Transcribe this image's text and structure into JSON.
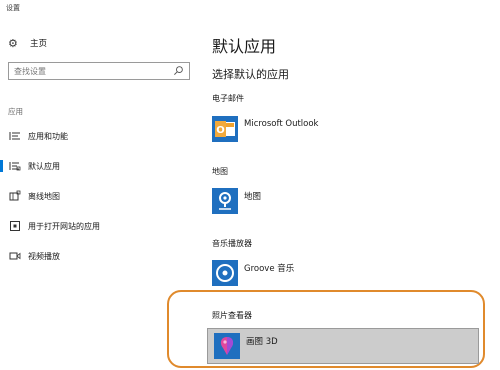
{
  "window": {
    "title": "设置"
  },
  "sidebar": {
    "home_label": "主页",
    "search_placeholder": "查找设置",
    "section_label": "应用",
    "items": [
      {
        "label": "应用和功能",
        "icon": "list-icon",
        "active": false
      },
      {
        "label": "默认应用",
        "icon": "default-apps-icon",
        "active": true
      },
      {
        "label": "离线地图",
        "icon": "map-icon",
        "active": false
      },
      {
        "label": "用于打开网站的应用",
        "icon": "website-apps-icon",
        "active": false
      },
      {
        "label": "视频播放",
        "icon": "video-icon",
        "active": false
      }
    ]
  },
  "main": {
    "title": "默认应用",
    "subtitle": "选择默认的应用",
    "categories": [
      {
        "label": "电子邮件",
        "app": "Microsoft Outlook",
        "icon": "outlook-icon"
      },
      {
        "label": "地图",
        "app": "地图",
        "icon": "maps-icon"
      },
      {
        "label": "音乐播放器",
        "app": "Groove 音乐",
        "icon": "groove-icon"
      },
      {
        "label": "照片查看器",
        "app": "画图 3D",
        "icon": "paint3d-icon",
        "highlighted": true
      }
    ]
  },
  "colors": {
    "accent": "#0078d7",
    "highlight_frame": "#e08a2c",
    "selected_bg": "#cccccc"
  }
}
